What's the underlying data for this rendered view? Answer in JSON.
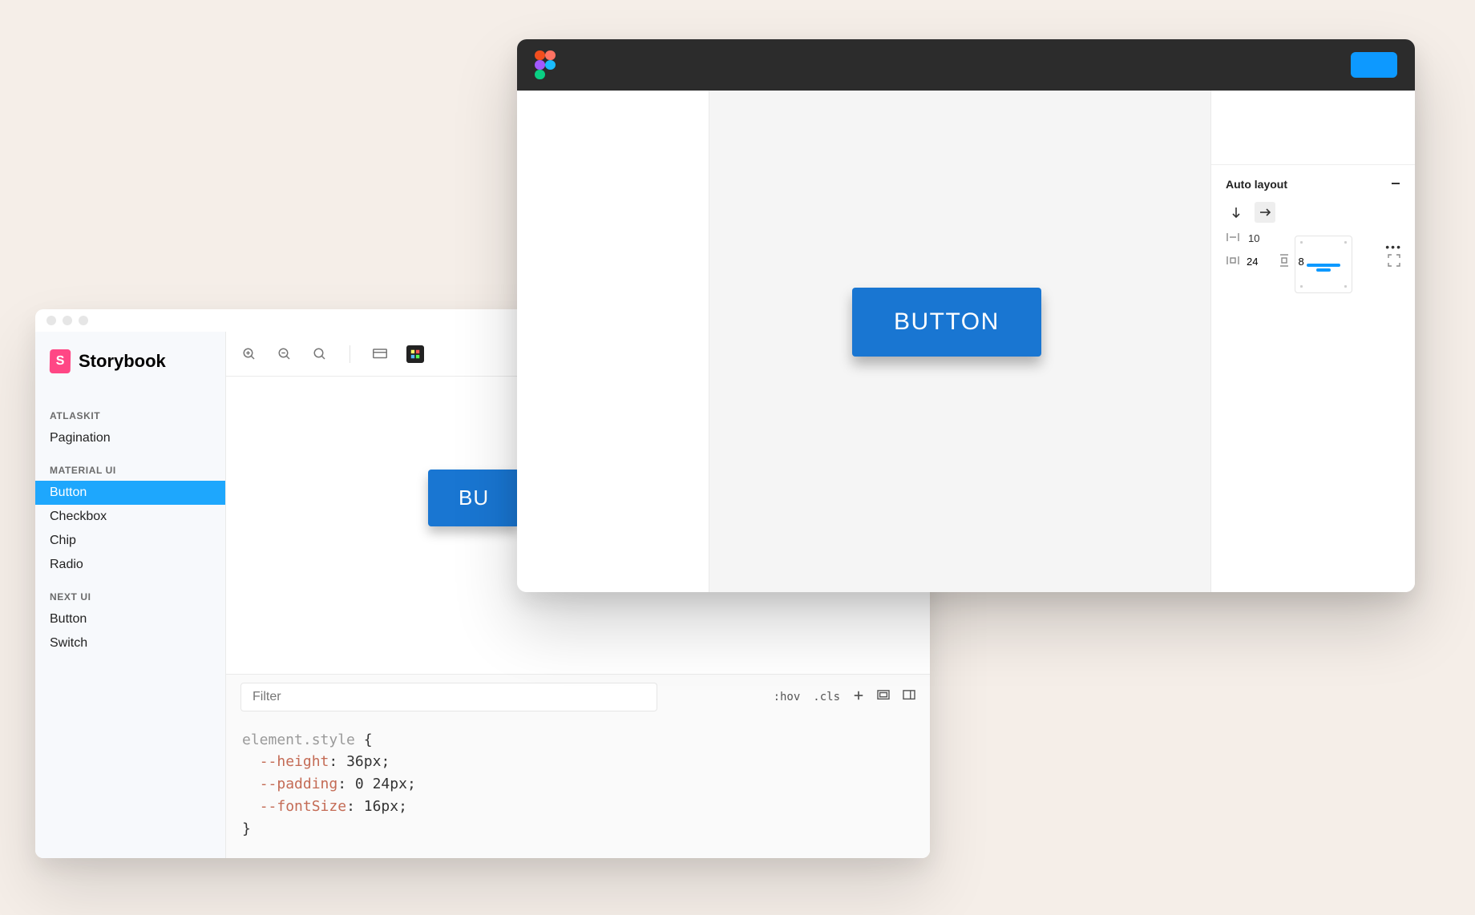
{
  "storybook": {
    "brand": "Storybook",
    "brand_initial": "S",
    "groups": [
      {
        "label": "ATLASKIT",
        "items": [
          "Pagination"
        ]
      },
      {
        "label": "MATERIAL UI",
        "items": [
          "Button",
          "Checkbox",
          "Chip",
          "Radio"
        ],
        "selected": "Button"
      },
      {
        "label": "NEXT UI",
        "items": [
          "Button",
          "Switch"
        ]
      }
    ],
    "canvas_button_label": "BU",
    "devtools": {
      "filter_placeholder": "Filter",
      "right_labels": {
        "hov": ":hov",
        "cls": ".cls"
      },
      "code": {
        "selector": "element.style",
        "rules": [
          {
            "prop": "--height",
            "value": "36px"
          },
          {
            "prop": "--padding",
            "value": "0 24px"
          },
          {
            "prop": "--fontSize",
            "value": "16px"
          }
        ]
      }
    }
  },
  "figma": {
    "canvas_button_label": "BUTTON",
    "panel": {
      "title": "Auto layout",
      "spacing": "10",
      "padding_horizontal": "24",
      "padding_vertical": "8"
    }
  }
}
